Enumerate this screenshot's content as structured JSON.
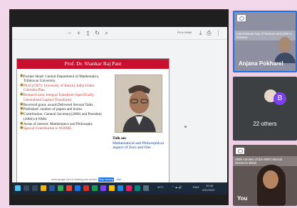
{
  "toolbar": {
    "fit_label": "Fit to Width",
    "icons": [
      "zoom-out-icon",
      "zoom-in-icon",
      "page-icon",
      "rotate-icon",
      "download-icon",
      "print-icon",
      "more-icon"
    ]
  },
  "slide": {
    "title": "Prof. Dr. Shankar Raj Pant",
    "bullets": [
      {
        "text": "Former Head: Central Department of Mathematics, Tribhuvan University",
        "color": "black"
      },
      {
        "text": "Ph.D.(1967): University of Ranchi, India Under Colombo Plan",
        "color": "red"
      },
      {
        "text": "Research area: Integral Transform (Specifically, Generalized Laplace Transform)",
        "color": "red"
      },
      {
        "text": "Received grant, award,Delivered Several Talks.",
        "color": "black"
      },
      {
        "text": "Published: number of papers and books",
        "color": "black"
      },
      {
        "text": "Contribution: General Secretary(2060) and President (2060) of NMS.",
        "color": "black"
      },
      {
        "text": "Areas of interest: Mathematics and Philosophy",
        "color": "black"
      },
      {
        "text": "Special Contribution to WiNMS",
        "color": "red"
      }
    ],
    "talk_heading": "Talk on:",
    "talk_text": "Mathematical and Philosophical Aspect of Zero and One"
  },
  "share_bar": {
    "text": "meet.google.com is sharing your screen.",
    "stop_label": "Stop sharing",
    "hide_label": "Hide"
  },
  "taskbar": {
    "temp": "32°C",
    "lang": "ENG",
    "time": "10:48",
    "date": "3/11/2022"
  },
  "participants": {
    "tile1": {
      "banner": "International Day of Women and Girls in Science",
      "name": "Anjana Pokharel"
    },
    "tile2": {
      "avatar_letter": "B",
      "others": "22 others"
    },
    "tile3": {
      "banner": "ISBN comitee of the NMS Internal Women's Week",
      "name": "You"
    }
  },
  "colors": {
    "slide_title_bar": "#c8102e",
    "accent": "#1a73e8",
    "background": "#efcfe3"
  }
}
